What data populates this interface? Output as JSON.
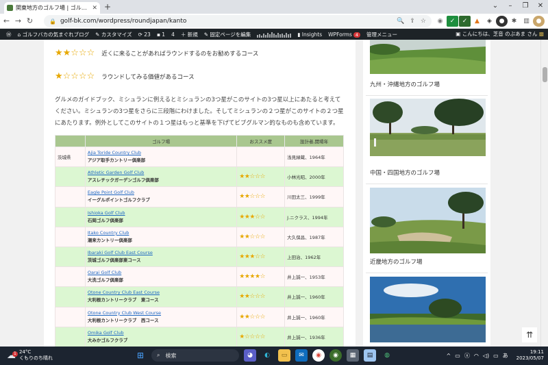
{
  "browser": {
    "tab_title": "関東地方のゴルフ場 | ゴルフバカの気",
    "url": "golf-bk.com/wordpress/roundjapan/kanto"
  },
  "wp_bar": {
    "site_name": "ゴルフバカの気まぐれブログ",
    "customize": "カスタマイズ",
    "updates": "23",
    "comments": "1",
    "comments_pending": "4",
    "new": "新規",
    "edit_page": "固定ページを編集",
    "insights": "Insights",
    "wpforms": "WPForms",
    "wpforms_count": "4",
    "admin_menu": "管理メニュー",
    "greeting": "こんにちは、芝音 のぶあま さん"
  },
  "ratings": [
    {
      "stars": "★★☆☆☆",
      "text": "近くに来ることがあればラウンドするのをお勧めするコース"
    },
    {
      "stars": "★☆☆☆☆",
      "text": "ラウンドしてみる価値があるコース"
    }
  ],
  "description": "グルメのガイドブック、ミシュランに例えるとミシュランの3つ星がこのサイトの3つ星以上にあたると考えてください。ミシュランの3つ星をさらに三段階にわけました。そしてミシュランの２つ星がこのサイトの２つ星にあたります。例外としてこのサイトの１つ星はもっと基準を下げてビブグルマン的なものも含めています。",
  "table": {
    "headers": [
      "",
      "ゴルフ場",
      "おススメ度",
      "設計者,開場年"
    ],
    "rows": [
      {
        "pref": "茨城県",
        "en": "Ajia Toride Country Club",
        "ja": "アジア取手カントリー倶楽部",
        "stars": "",
        "designer": "浅見緑蔵、1964年"
      },
      {
        "pref": "",
        "en": "Athletic Garden Golf Club",
        "ja": "アスレチックガーデンゴルフ倶楽部",
        "stars": "★★☆☆☆",
        "designer": "小林光昭、2000年"
      },
      {
        "pref": "",
        "en": "Eagle Point Golf Club",
        "ja": "イーグルポイントゴルフクラブ",
        "stars": "★★☆☆☆",
        "designer": "川田太三、1999年"
      },
      {
        "pref": "",
        "en": "Ishioka Golf Club",
        "ja": "石岡ゴルフ倶楽部",
        "stars": "★★★☆☆",
        "designer": "J.ニクラス、1994年"
      },
      {
        "pref": "",
        "en": "Itako Country Club",
        "ja": "潮来カントリー倶楽部",
        "stars": "★★☆☆☆",
        "designer": "大久保昌、1987年"
      },
      {
        "pref": "",
        "en": "Ibaraki Golf Club East Course",
        "ja": "茨城ゴルフ倶楽部東コース",
        "stars": "★★★☆☆",
        "designer": "上田治、1962年"
      },
      {
        "pref": "",
        "en": "Oarai Golf Club",
        "ja": "大洗ゴルフ倶楽部",
        "stars": "★★★★☆",
        "designer": "井上誠一、1953年"
      },
      {
        "pref": "",
        "en": "Otone Country Club East Course",
        "ja": "大利根カントリークラブ　東コース",
        "stars": "★★☆☆☆",
        "designer": "井上誠一、1960年"
      },
      {
        "pref": "",
        "en": "Otone Country Club West Course",
        "ja": "大利根カントリークラブ　西コース",
        "stars": "★★☆☆☆",
        "designer": "井上誠一、1960年"
      },
      {
        "pref": "",
        "en": "Omika Golf Club",
        "ja": "大みかゴルフクラブ",
        "stars": "★☆☆☆☆",
        "designer": "井上誠一、1936年"
      }
    ]
  },
  "sidebar": [
    {
      "caption": "九州・沖縄地方のゴルフ場"
    },
    {
      "caption": "中国・四国地方のゴルフ場"
    },
    {
      "caption": "近畿地方のゴルフ場"
    }
  ],
  "taskbar": {
    "temp": "24°C",
    "weather": "くもりのち晴れ",
    "weather_badge": "1",
    "search": "検索",
    "time": "19:11",
    "date": "2023/05/07"
  }
}
